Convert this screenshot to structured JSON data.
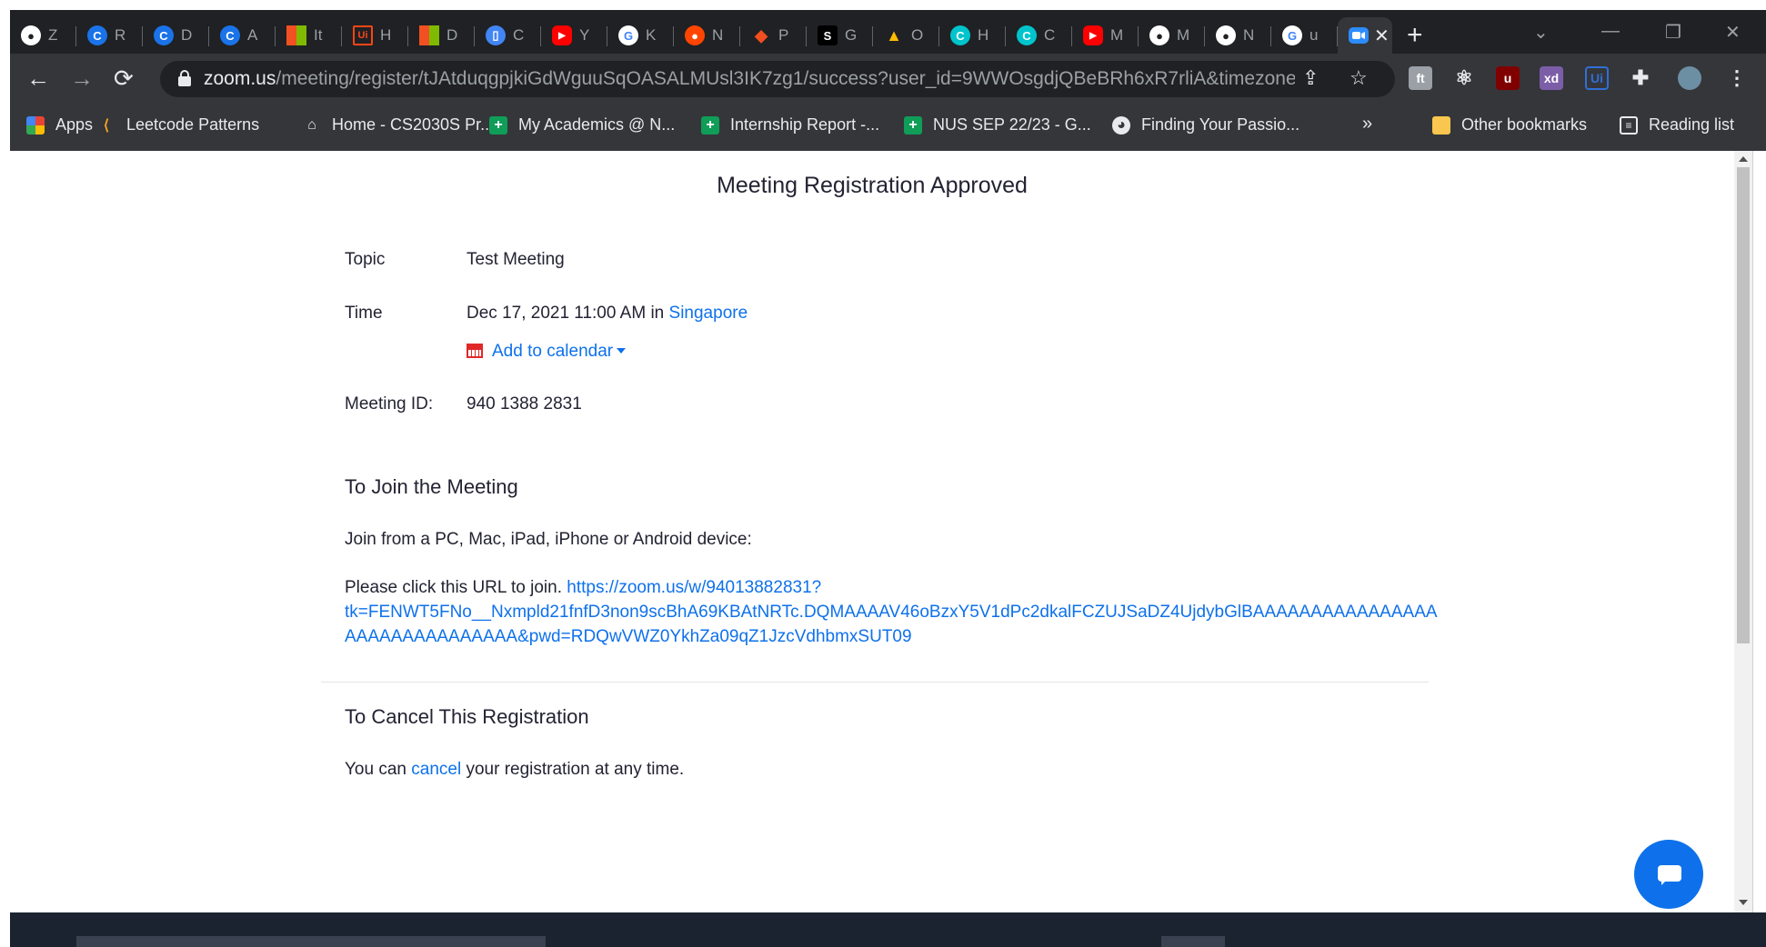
{
  "browser": {
    "tabs": [
      {
        "icon": "github-icon",
        "title": "Z",
        "color": "#ffffff"
      },
      {
        "icon": "c-icon",
        "title": "R",
        "color": "#1a73e8"
      },
      {
        "icon": "c-icon",
        "title": "D",
        "color": "#1a73e8"
      },
      {
        "icon": "c-icon",
        "title": "A",
        "color": "#1a73e8"
      },
      {
        "icon": "microsoft-icon",
        "title": "It",
        "color": "#f25022"
      },
      {
        "icon": "uipath-icon",
        "title": "H",
        "color": "#fa4616"
      },
      {
        "icon": "microsoft-icon",
        "title": "D",
        "color": "#f25022"
      },
      {
        "icon": "app-icon",
        "title": "C",
        "color": "#4285f4"
      },
      {
        "icon": "youtube-icon",
        "title": "Y",
        "color": "#ff0000"
      },
      {
        "icon": "google-icon",
        "title": "K",
        "color": "#ffffff"
      },
      {
        "icon": "reddit-icon",
        "title": "N",
        "color": "#ff4500"
      },
      {
        "icon": "figma-icon",
        "title": "P",
        "color": "#a259ff"
      },
      {
        "icon": "s-icon",
        "title": "G",
        "color": "#000000"
      },
      {
        "icon": "drive-icon",
        "title": "O",
        "color": "#0f9d58"
      },
      {
        "icon": "canva-icon",
        "title": "H",
        "color": "#00c4cc"
      },
      {
        "icon": "canva-icon",
        "title": "C",
        "color": "#00c4cc"
      },
      {
        "icon": "youtube-icon",
        "title": "M",
        "color": "#ff0000"
      },
      {
        "icon": "github-icon",
        "title": "M",
        "color": "#ffffff"
      },
      {
        "icon": "github-icon",
        "title": "N",
        "color": "#ffffff"
      },
      {
        "icon": "google-icon",
        "title": "u",
        "color": "#ffffff"
      }
    ],
    "active_tab": {
      "icon": "zoom-icon",
      "close": "✕"
    },
    "new_tab": "+",
    "url_host": "zoom.us",
    "url_path": "/meeting/register/tJAtduqgpjkiGdWguuSqOASALMUsl3IK7zg1/success?user_id=9WWOsgdjQBeBRh6xR7rliA&timezone...",
    "bookmarks": [
      {
        "icon": "apps-icon",
        "label": "Apps"
      },
      {
        "icon": "leetcode-icon",
        "label": "Leetcode Patterns"
      },
      {
        "icon": "home-icon",
        "label": "Home - CS2030S Pr..."
      },
      {
        "icon": "sheets-icon",
        "label": "My Academics @ N..."
      },
      {
        "icon": "sheets-icon",
        "label": "Internship Report -..."
      },
      {
        "icon": "sheets-icon",
        "label": "NUS SEP 22/23 - G..."
      },
      {
        "icon": "globe-icon",
        "label": "Finding Your Passio..."
      }
    ],
    "more_bookmarks": "»",
    "other_bookmarks": "Other bookmarks",
    "reading_list": "Reading list"
  },
  "page": {
    "title": "Meeting Registration Approved",
    "topic_label": "Topic",
    "topic_value": "Test Meeting",
    "time_label": "Time",
    "time_value": "Dec 17, 2021 11:00 AM in ",
    "time_zone": "Singapore",
    "add_to_calendar": "Add to calendar",
    "meeting_id_label": "Meeting ID:",
    "meeting_id_value": "940 1388 2831",
    "join_title": "To Join the Meeting",
    "join_devices": "Join from a PC, Mac, iPad, iPhone or Android device:",
    "join_prompt": "Please click this URL to join. ",
    "join_url_line1": "https://zoom.us/w/94013882831?",
    "join_url_line2": "tk=FENWT5FNo__Nxmpld21fnfD3non9scBhA69KBAtNRTc.DQMAAAAV46oBzxY5V1dPc2dkalFCZUJSaDZ4UjdybGlBAAAAAAAAAAAAAAAA",
    "join_url_line3": "AAAAAAAAAAAAAAA&pwd=RDQwVWZ0YkhZa09qZ1JzcVdhbmxSUT09",
    "cancel_title": "To Cancel This Registration",
    "cancel_pre": "You can ",
    "cancel_link": "cancel",
    "cancel_post": " your registration at any time."
  },
  "colors": {
    "link": "#0e71eb",
    "text": "#232333",
    "chrome_bg": "#202124",
    "toolbar_bg": "#35363a"
  }
}
